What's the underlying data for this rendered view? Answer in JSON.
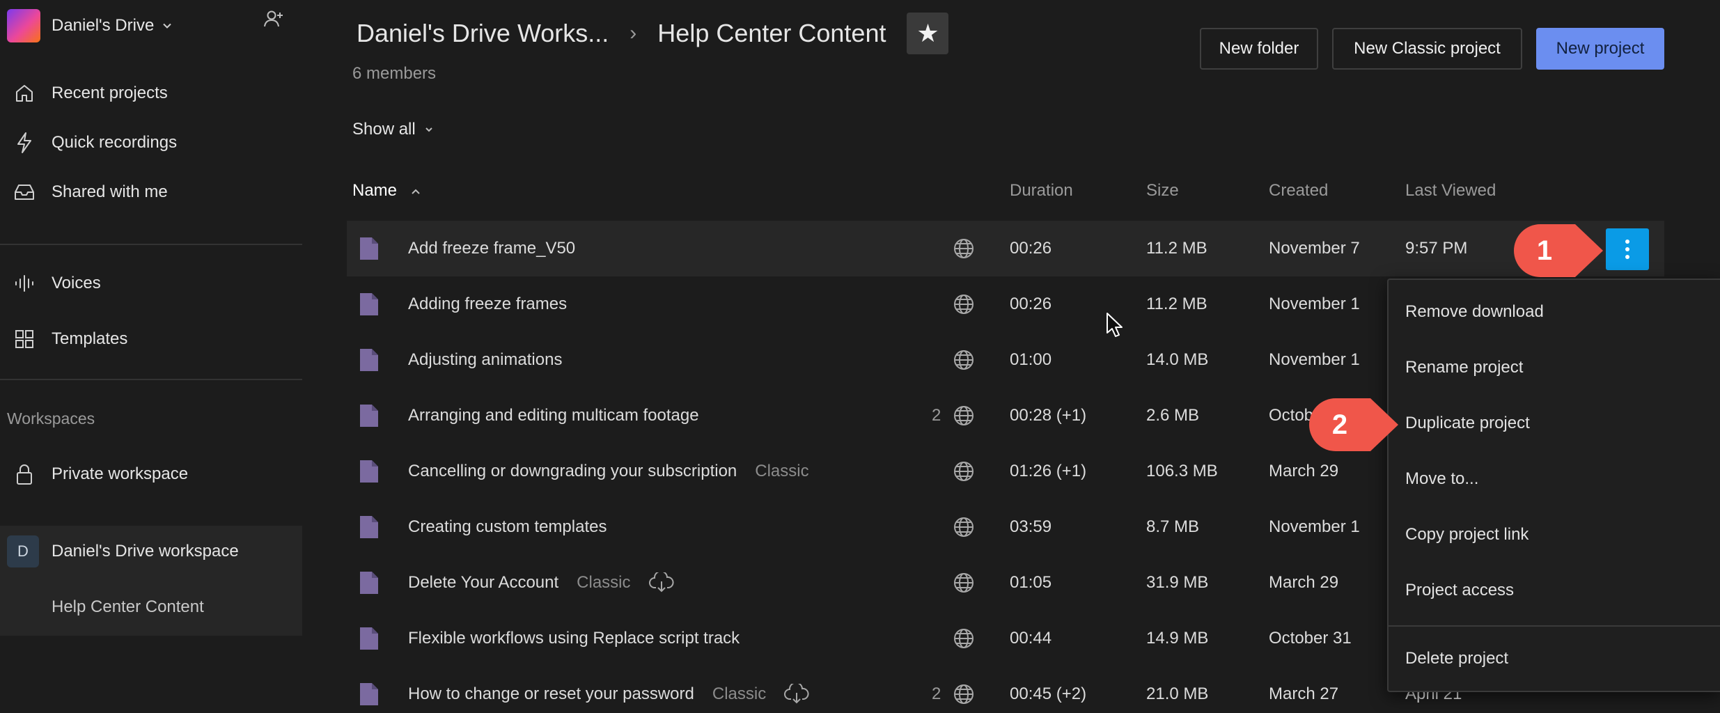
{
  "sidebar": {
    "drive_name": "Daniel's Drive",
    "nav": [
      {
        "label": "Recent projects",
        "icon": "home-icon"
      },
      {
        "label": "Quick recordings",
        "icon": "lightning-icon"
      },
      {
        "label": "Shared with me",
        "icon": "inbox-icon"
      },
      {
        "label": "Voices",
        "icon": "waveform-icon"
      },
      {
        "label": "Templates",
        "icon": "grid-icon"
      }
    ],
    "workspaces_label": "Workspaces",
    "private_workspace": "Private workspace",
    "workspace": {
      "avatar_letter": "D",
      "name": "Daniel's Drive workspace",
      "child": "Help Center Content"
    }
  },
  "header": {
    "breadcrumb_parent": "Daniel's Drive Works...",
    "breadcrumb_current": "Help Center Content",
    "members": "6 members",
    "new_folder": "New folder",
    "new_classic_project": "New Classic project",
    "new_project": "New project",
    "show_all": "Show all",
    "accent_color": "#6b8ef0"
  },
  "table": {
    "columns": {
      "name": "Name",
      "duration": "Duration",
      "size": "Size",
      "created": "Created",
      "last_viewed": "Last Viewed"
    },
    "rows": [
      {
        "name": "Add freeze frame_V50",
        "tag": "",
        "versions": "",
        "duration": "00:26",
        "size": "11.2 MB",
        "created": "November 7",
        "last_viewed": "9:57 PM"
      },
      {
        "name": "Adding freeze frames",
        "tag": "",
        "versions": "",
        "duration": "00:26",
        "size": "11.2 MB",
        "created": "November 1",
        "last_viewed": ""
      },
      {
        "name": "Adjusting animations",
        "tag": "",
        "versions": "",
        "duration": "01:00",
        "size": "14.0 MB",
        "created": "November 1",
        "last_viewed": ""
      },
      {
        "name": "Arranging and editing multicam footage",
        "tag": "",
        "versions": "2",
        "duration": "00:28 (+1)",
        "size": "2.6 MB",
        "created": "Octob",
        "last_viewed": ""
      },
      {
        "name": "Cancelling or downgrading your subscription",
        "tag": "Classic",
        "versions": "",
        "duration": "01:26 (+1)",
        "size": "106.3 MB",
        "created": "March 29",
        "last_viewed": ""
      },
      {
        "name": "Creating custom templates",
        "tag": "",
        "versions": "",
        "duration": "03:59",
        "size": "8.7 MB",
        "created": "November 1",
        "last_viewed": ""
      },
      {
        "name": "Delete Your Account",
        "tag": "Classic",
        "versions": "",
        "duration": "01:05",
        "size": "31.9 MB",
        "created": "March 29",
        "last_viewed": ""
      },
      {
        "name": "Flexible workflows using Replace script track",
        "tag": "",
        "versions": "",
        "duration": "00:44",
        "size": "14.9 MB",
        "created": "October 31",
        "last_viewed": ""
      },
      {
        "name": "How to change or reset your password",
        "tag": "Classic",
        "versions": "2",
        "duration": "00:45 (+2)",
        "size": "21.0 MB",
        "created": "March 27",
        "last_viewed": "April 21"
      }
    ]
  },
  "context_menu": {
    "items": [
      "Remove download",
      "Rename project",
      "Duplicate project",
      "Move to...",
      "Copy project link",
      "Project access"
    ],
    "danger_item": "Delete project"
  },
  "callouts": {
    "one": "1",
    "two": "2",
    "color": "#f0564a"
  }
}
